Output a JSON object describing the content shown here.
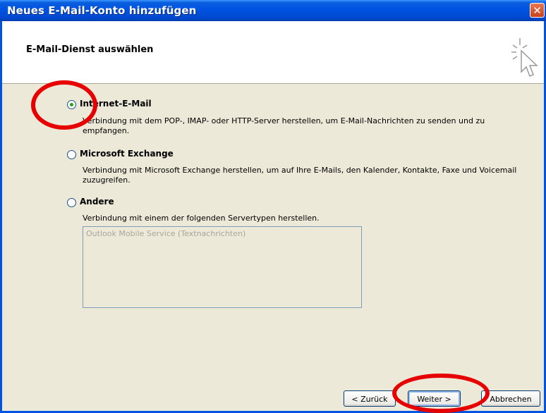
{
  "window": {
    "title": "Neues E-Mail-Konto hinzufügen",
    "close_glyph": "✕"
  },
  "header": {
    "heading": "E-Mail-Dienst auswählen",
    "icon": "cursor-sparkle-icon"
  },
  "options": [
    {
      "label": "Internet-E-Mail",
      "description": "Verbindung mit dem POP-, IMAP- oder HTTP-Server herstellen, um E-Mail-Nachrichten zu senden und zu empfangen.",
      "selected": true
    },
    {
      "label": "Microsoft Exchange",
      "description": "Verbindung mit Microsoft Exchange herstellen, um auf Ihre E-Mails, den Kalender, Kontakte, Faxe und Voicemail zuzugreifen.",
      "selected": false
    },
    {
      "label": "Andere",
      "description": "Verbindung mit einem der folgenden Servertypen herstellen.",
      "selected": false
    }
  ],
  "server_types": [
    "Outlook Mobile Service (Textnachrichten)"
  ],
  "buttons": {
    "back": "< Zurück",
    "next": "Weiter >",
    "cancel": "Abbrechen"
  },
  "annotation_color": "#e60000"
}
